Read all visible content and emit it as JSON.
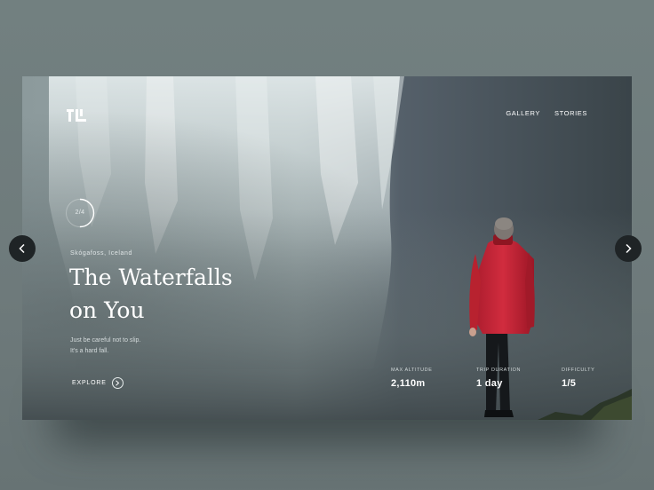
{
  "brand": {
    "logo_icon": "brand-logo-icon"
  },
  "nav": {
    "items": [
      {
        "label": "GALLERY"
      },
      {
        "label": "STORIES"
      }
    ]
  },
  "slider": {
    "counter": "2/4",
    "progress": 0.5,
    "prev_icon": "chevron-left-icon",
    "next_icon": "chevron-right-icon"
  },
  "hero": {
    "location": "Skógafoss, Iceland",
    "title_line1": "The Waterfalls",
    "title_line2": "on You",
    "tagline_line1": "Just be careful not to slip.",
    "tagline_line2": "It's a hard fall.",
    "cta_label": "EXPLORE",
    "cta_icon": "chevron-right-icon"
  },
  "stats": [
    {
      "label": "MAX ALTITUDE",
      "value": "2,110m"
    },
    {
      "label": "TRIP DURATION",
      "value": "1 day"
    },
    {
      "label": "DIFFICULTY",
      "value": "1/5"
    }
  ],
  "colors": {
    "page_bg": "#6f7b7c",
    "jacket": "#c8283a",
    "nav_button": "#1f2426",
    "text": "#ffffff"
  }
}
